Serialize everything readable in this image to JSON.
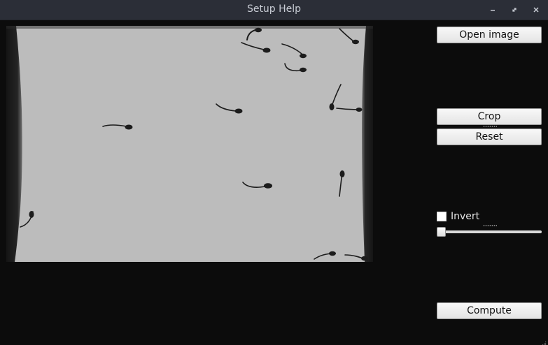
{
  "window": {
    "title": "Setup Help",
    "controls": [
      "minimize-icon",
      "maximize-icon",
      "close-icon"
    ]
  },
  "toolbar": {
    "open_label": "Open image",
    "crop_label": "Crop",
    "reset_label": "Reset",
    "compute_label": "Compute"
  },
  "invert": {
    "label": "Invert",
    "checked": false
  },
  "threshold_slider": {
    "value_fraction": 0
  },
  "colors": {
    "background": "#0c0c0c",
    "titlebar": "#2b2e37",
    "title_text": "#c8ccd4",
    "image_background": "#bdbdbd",
    "image_walls": "#1a1a1a",
    "fish": "#1c1c1c"
  }
}
